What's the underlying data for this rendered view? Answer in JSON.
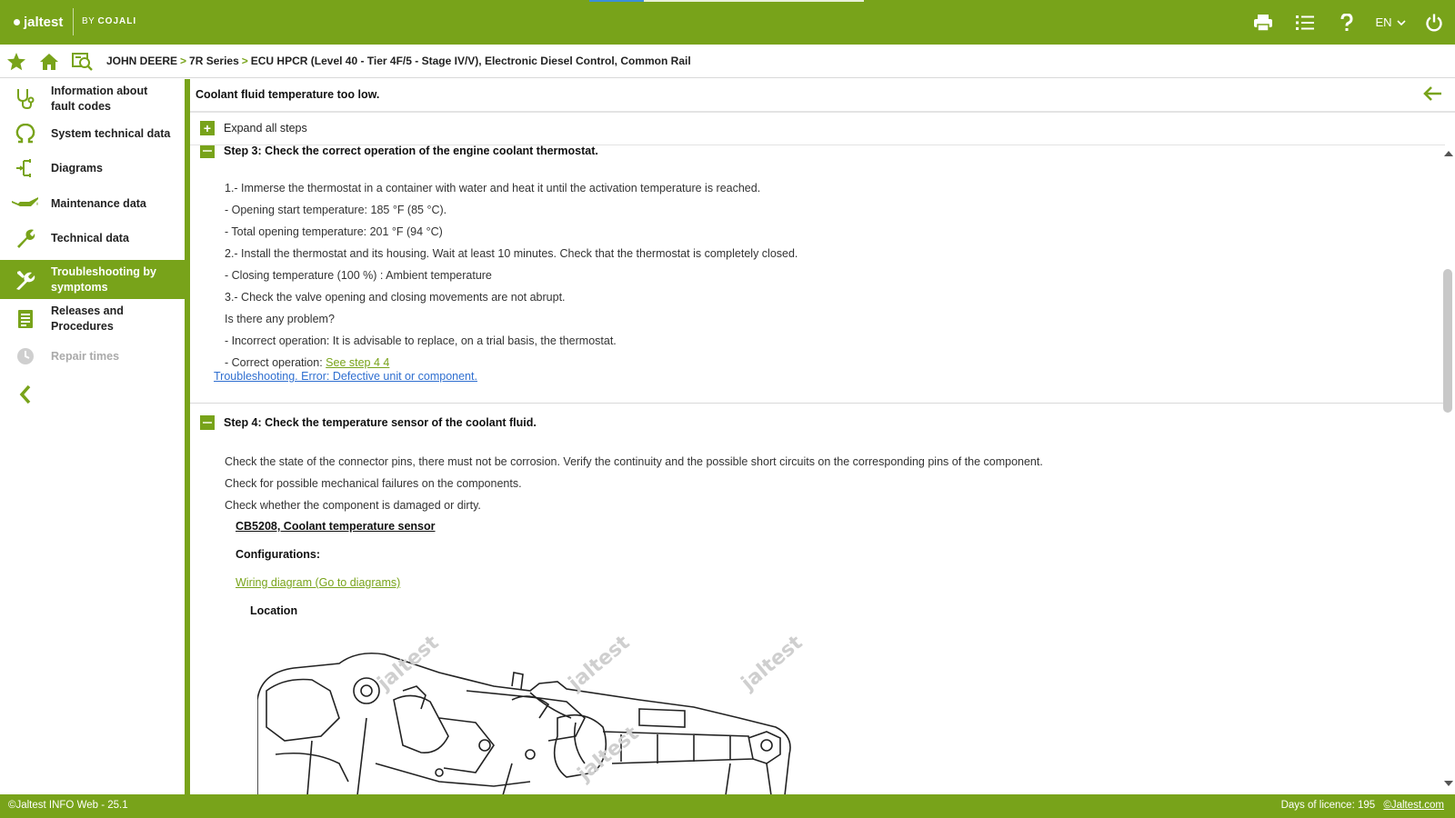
{
  "header": {
    "logo_text": "jaltest",
    "by_label": "BY",
    "brand_label": "COJALI",
    "language": "EN",
    "icons": [
      "print-icon",
      "list-icon",
      "help-icon",
      "power-icon"
    ]
  },
  "breadcrumb": {
    "items": [
      "JOHN DEERE",
      "7R Series",
      "ECU HPCR (Level 40 - Tier 4F/5 - Stage IV/V), Electronic Diesel Control, Common Rail"
    ],
    "separator": ">"
  },
  "sidebar": {
    "items": [
      {
        "label": "Information about fault codes",
        "icon": "stethoscope-icon"
      },
      {
        "label": "System technical data",
        "icon": "ohm-icon"
      },
      {
        "label": "Diagrams",
        "icon": "diagram-icon"
      },
      {
        "label": "Maintenance data",
        "icon": "oil-can-icon"
      },
      {
        "label": "Technical data",
        "icon": "wrench-icon"
      },
      {
        "label": "Troubleshooting by symptoms",
        "icon": "tools-icon"
      },
      {
        "label": "Releases and Procedures",
        "icon": "document-icon"
      },
      {
        "label": "Repair times",
        "icon": "clock-icon"
      }
    ],
    "active_item": "Troubleshooting by symptoms",
    "disabled_item": "Repair times"
  },
  "main": {
    "title": "Coolant fluid temperature too low.",
    "expand_all_label": "Expand all steps",
    "step3": {
      "title": "Step 3: Check the correct operation of the engine coolant thermostat.",
      "lines": [
        "1.- Immerse the thermostat in a container with water and heat it until the activation temperature is reached.",
        "- Opening start temperature: 185 °F (85 °C).",
        "- Total opening temperature: 201 °F (94 °C)",
        "2.- Install the thermostat and its housing. Wait at least 10 minutes. Check that the thermostat is completely closed.",
        "- Closing temperature (100 %) : Ambient temperature",
        "3.- Check the valve opening and closing movements are not abrupt.",
        "Is there any problem?",
        "- Incorrect operation: It is advisable to replace, on a trial basis, the thermostat."
      ],
      "correct_prefix": "- Correct operation: ",
      "correct_link": "See step 4 4",
      "error_link": "Troubleshooting. Error: Defective unit or component."
    },
    "step4": {
      "title": "Step 4: Check the temperature sensor of the coolant fluid.",
      "lines": [
        "Check the state of the connector pins, there must not be corrosion. Verify the continuity and the possible short circuits on the corresponding pins of the component.",
        "Check for possible mechanical failures on the components.",
        "Check whether the component is damaged or dirty."
      ],
      "component": "CB5208, Coolant temperature sensor",
      "configurations_label": "Configurations:",
      "wiring_link": "Wiring diagram (Go to diagrams)",
      "location_label": "Location",
      "watermark": "jaltest"
    }
  },
  "footer": {
    "version": "©Jaltest INFO Web - 25.1",
    "licence_label": "Days of licence: 195",
    "site_link": "©Jaltest.com"
  },
  "colors": {
    "brand_green": "#78a31a",
    "link_blue": "#2f6fd0"
  }
}
